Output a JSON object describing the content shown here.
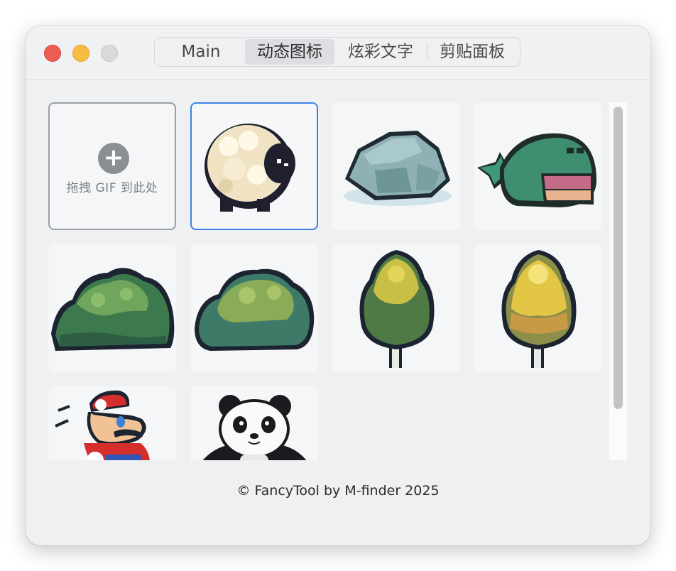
{
  "tabs": [
    {
      "label": "Main",
      "selected": false
    },
    {
      "label": "动态图标",
      "selected": true
    },
    {
      "label": "炫彩文字",
      "selected": false
    },
    {
      "label": "剪贴面板",
      "selected": false
    }
  ],
  "drop_zone": {
    "icon": "+",
    "label": "拖拽 GIF 到此处"
  },
  "gallery": [
    {
      "name": "sheep",
      "selected": true
    },
    {
      "name": "rock",
      "selected": false
    },
    {
      "name": "whale",
      "selected": false
    },
    {
      "name": "bush-dark",
      "selected": false
    },
    {
      "name": "bush-light",
      "selected": false
    },
    {
      "name": "tree-green",
      "selected": false
    },
    {
      "name": "tree-yellow",
      "selected": false
    },
    {
      "name": "mario",
      "selected": false
    },
    {
      "name": "panda",
      "selected": false
    }
  ],
  "footer": {
    "text": "© FancyTool by M-finder 2025"
  },
  "colors": {
    "accent": "#3e82e6",
    "close": "#ee5c56",
    "minimize": "#f7bd40",
    "zoom": "#d9dadb"
  }
}
